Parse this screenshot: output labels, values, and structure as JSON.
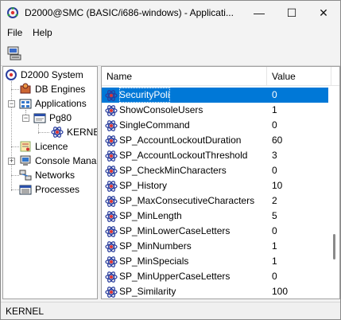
{
  "window": {
    "title": "D2000@SMC (BASIC/i686-windows) - Applicati...",
    "minimize_glyph": "—",
    "maximize_glyph": "☐",
    "close_glyph": "✕"
  },
  "menu": {
    "file": "File",
    "help": "Help"
  },
  "toolbar": {
    "connect_icon": "server-connect-icon"
  },
  "tree": {
    "root": "D2000 System",
    "db_engines": "DB Engines",
    "applications": "Applications",
    "pg80": "Pg80",
    "kernel": "KERNEL",
    "licence": "Licence",
    "console": "Console Mana",
    "networks": "Networks",
    "processes": "Processes"
  },
  "list": {
    "col_name": "Name",
    "col_value": "Value",
    "rows": [
      {
        "name": "SecurityPolicy",
        "value": "0"
      },
      {
        "name": "ShowConsoleUsers",
        "value": "1"
      },
      {
        "name": "SingleCommand",
        "value": "0"
      },
      {
        "name": "SP_AccountLockoutDuration",
        "value": "60"
      },
      {
        "name": "SP_AccountLockoutThreshold",
        "value": "3"
      },
      {
        "name": "SP_CheckMinCharacters",
        "value": "0"
      },
      {
        "name": "SP_History",
        "value": "10"
      },
      {
        "name": "SP_MaxConsecutiveCharacters",
        "value": "2"
      },
      {
        "name": "SP_MinLength",
        "value": "5"
      },
      {
        "name": "SP_MinLowerCaseLetters",
        "value": "0"
      },
      {
        "name": "SP_MinNumbers",
        "value": "1"
      },
      {
        "name": "SP_MinSpecials",
        "value": "1"
      },
      {
        "name": "SP_MinUpperCaseLetters",
        "value": "0"
      },
      {
        "name": "SP_Similarity",
        "value": "100"
      }
    ]
  },
  "status": {
    "text": "KERNEL"
  },
  "colors": {
    "selection": "#0078d7"
  }
}
